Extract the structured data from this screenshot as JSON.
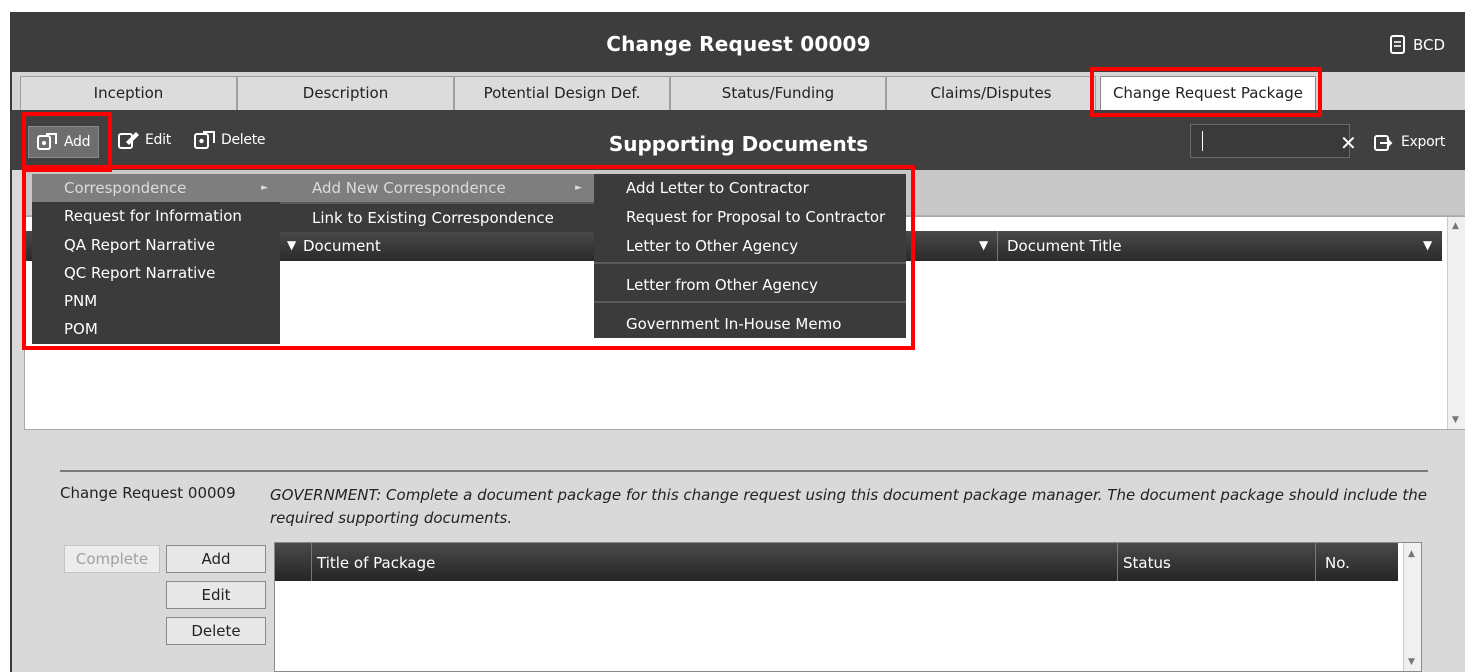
{
  "window": {
    "title": "Change Request 00009",
    "bcd_label": "BCD"
  },
  "tabs": [
    {
      "label": "Inception"
    },
    {
      "label": "Description"
    },
    {
      "label": "Potential Design Def."
    },
    {
      "label": "Status/Funding"
    },
    {
      "label": "Claims/Disputes"
    },
    {
      "label": "Change Request Package",
      "active": true
    }
  ],
  "toolbar": {
    "section_title": "Supporting Documents",
    "add_label": "Add",
    "edit_label": "Edit",
    "delete_label": "Delete",
    "export_label": "Export",
    "search": {
      "value": "",
      "clear_icon": "close-icon"
    }
  },
  "documents_grid": {
    "columns": [
      "Document",
      "Document Title"
    ],
    "rows": []
  },
  "add_menu": {
    "items": [
      {
        "label": "Correspondence",
        "has_submenu": true,
        "highlighted": true
      },
      {
        "label": "Request for Information"
      },
      {
        "label": "QA Report Narrative"
      },
      {
        "label": "QC Report Narrative"
      },
      {
        "label": "PNM"
      },
      {
        "label": "POM"
      }
    ],
    "correspondence_submenu": [
      {
        "label": "Add New Correspondence",
        "has_submenu": true,
        "highlighted": true
      },
      {
        "label": "Link to Existing Correspondence"
      }
    ],
    "new_correspondence_submenu": [
      {
        "label": "Add Letter to Contractor"
      },
      {
        "label": "Request for Proposal to Contractor"
      },
      {
        "label": "Letter to Other Agency"
      },
      {
        "label": "Letter from Other Agency"
      },
      {
        "label": "Government In-House Memo"
      }
    ]
  },
  "package_section": {
    "label": "Change Request 00009",
    "instructions": "GOVERNMENT: Complete a document package for this change request using this document package manager. The document package should include the required supporting documents.",
    "buttons": {
      "complete": "Complete",
      "add": "Add",
      "edit": "Edit",
      "delete": "Delete"
    },
    "columns": [
      "Title of Package",
      "Status",
      "No."
    ],
    "rows": []
  },
  "colors": {
    "title_bar": "#3d3d3d",
    "toolbar": "#404040",
    "menu_bg": "#3b3b3b",
    "menu_highlight": "#7e7e7e",
    "callout": "#ff0000"
  }
}
